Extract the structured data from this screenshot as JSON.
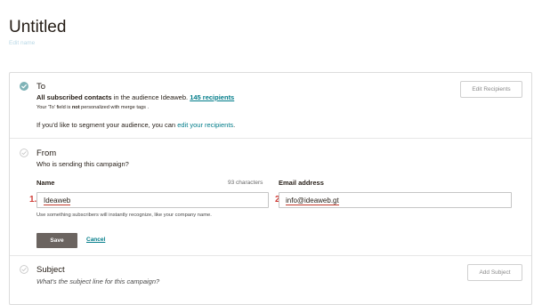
{
  "page": {
    "title": "Untitled",
    "edit_name_label": "Edit name"
  },
  "to_section": {
    "title": "To",
    "audience_prefix": "All subscribed contacts",
    "audience_mid": " in the audience ",
    "audience_name": "Ideaweb.",
    "recipients_link": "145 recipients",
    "note_prefix": "Your 'To' field is ",
    "note_bold": "not",
    "note_suffix": " personalized with merge tags .",
    "segment_prefix": "If you'd like to segment your audience, you can ",
    "segment_link": "edit your recipients",
    "segment_suffix": ".",
    "edit_button": "Edit Recipients"
  },
  "from_section": {
    "title": "From",
    "subtitle": "Who is sending this campaign?",
    "name_label": "Name",
    "char_count": "93 characters",
    "email_label": "Email address",
    "name_marker": "1.",
    "email_marker": "2.",
    "name_value": "Ideaweb",
    "email_value": "info@ideaweb.gt",
    "helper_text": "Use something subscribers will instantly recognize, like your company name.",
    "save_label": "Save",
    "cancel_label": "Cancel"
  },
  "subject_section": {
    "title": "Subject",
    "subtitle": "What's the subject line for this campaign?",
    "add_button": "Add Subject"
  },
  "colors": {
    "accent_teal": "#007c89",
    "check_green": "#7fb3b7",
    "marker_red": "#d1403a",
    "save_button": "#6b6460"
  },
  "icons": {
    "to_status": "check-circle-filled-icon",
    "from_status": "check-circle-outline-icon",
    "subject_status": "check-circle-outline-icon"
  }
}
